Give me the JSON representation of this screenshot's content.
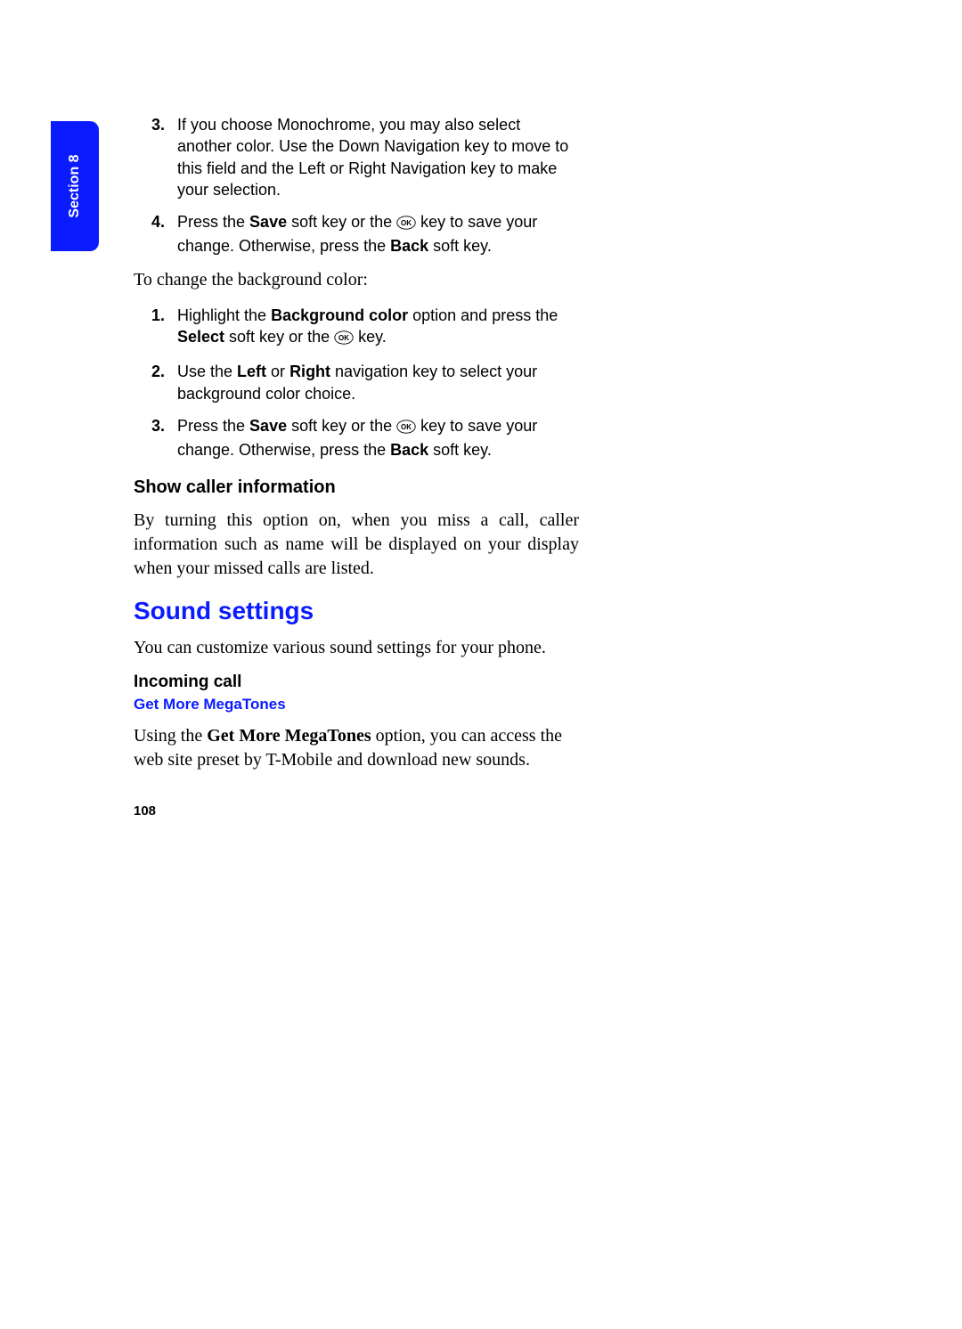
{
  "section_tab": "Section 8",
  "list_a": {
    "3": {
      "n": "3.",
      "text": "If you choose Monochrome, you may also select another color. Use the Down Navigation key to move to this field and the Left or Right Navigation key to make your selection."
    },
    "4": {
      "n": "4.",
      "pre": "Press the ",
      "b1": "Save",
      "mid1": " soft key or the ",
      "mid2": " key to save your change. Otherwise, press the ",
      "b2": "Back",
      "post": " soft key."
    }
  },
  "intro_bg": "To change the background color:",
  "list_b": {
    "1": {
      "n": "1.",
      "pre": "Highlight the ",
      "b1": "Background color",
      "mid1": " option and press the ",
      "b2": "Select",
      "mid2": " soft key or the ",
      "post": " key."
    },
    "2": {
      "n": "2.",
      "pre": "Use the ",
      "b1": "Left",
      "mid1": " or ",
      "b2": "Right",
      "post": " navigation key to select your background color choice."
    },
    "3": {
      "n": "3.",
      "pre": "Press the ",
      "b1": "Save",
      "mid1": " soft key or the ",
      "mid2": " key to save your change. Otherwise, press the ",
      "b2": "Back",
      "post": " soft key."
    }
  },
  "h_caller": "Show caller information",
  "p_caller": "By turning this option on, when you miss a call, caller information such as name will be displayed on your display when your missed calls are listed.",
  "h_sound": "Sound settings",
  "p_sound": "You can customize various sound settings for your phone.",
  "h_incoming": "Incoming call",
  "h_mega": "Get More MegaTones",
  "p_mega_pre": "Using the ",
  "p_mega_b": "Get More MegaTones",
  "p_mega_post": " option, you can access the web site preset by T-Mobile and download new sounds.",
  "page_number": "108"
}
